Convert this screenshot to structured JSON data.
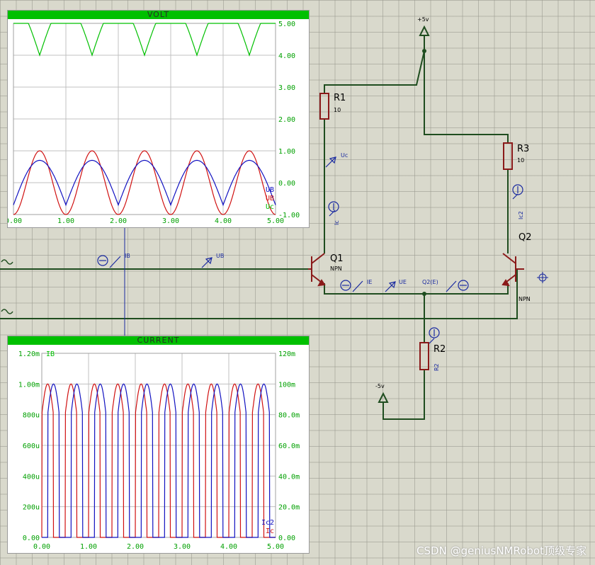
{
  "colors": {
    "wire": "#1f4d1f",
    "component": "#8b1a1a",
    "probe": "#1a2aa0",
    "trace_green": "#00c000",
    "trace_red": "#d01010",
    "trace_blue": "#1010c0"
  },
  "schematic": {
    "power_top": "+5v",
    "power_bottom": "-5v",
    "r1": {
      "name": "R1",
      "value": "10"
    },
    "r2": {
      "name": "R2"
    },
    "r3": {
      "name": "R3",
      "value": "10"
    },
    "q1": {
      "name": "Q1",
      "type": "NPN"
    },
    "q2": {
      "name": "Q2",
      "type": "NPN"
    },
    "probes": {
      "uc": "Uc",
      "ic": "Ic",
      "ic2": "Ic2",
      "ib": "IB",
      "ub": "UB",
      "ie": "IE",
      "ue": "UE",
      "q2e": "Q2(E)",
      "r2_probe": "R2"
    }
  },
  "watermark": "CSDN @geniusNMRobot顶级专家",
  "chart_data": [
    {
      "type": "line",
      "title": "VOLT",
      "x_ticks": [
        "0.00",
        "1.00",
        "2.00",
        "3.00",
        "4.00",
        "5.00"
      ],
      "y_ticks": [
        "5.00",
        "4.00",
        "3.00",
        "2.00",
        "1.00",
        "0.00",
        "-1.00"
      ],
      "xlim": [
        0,
        5
      ],
      "ylim": [
        -1,
        5
      ],
      "legend": [
        "UB",
        "UB",
        "Uc"
      ],
      "series": [
        {
          "name": "Uc",
          "color": "#00c000",
          "kind": "clipped_top",
          "high": 5.0,
          "low": 4.0,
          "period": 1.0,
          "phase": 0.0
        },
        {
          "name": "UB",
          "color": "#d01010",
          "kind": "sine",
          "amplitude": 1.0,
          "offset": 0.0,
          "period": 1.0,
          "phase": 0.25
        },
        {
          "name": "UB",
          "color": "#1010c0",
          "kind": "abs_sine",
          "amplitude": 0.7,
          "offset": -0.7,
          "period": 1.0,
          "phase": 0.0
        }
      ]
    },
    {
      "type": "line",
      "title": "CURRENT",
      "x_ticks": [
        "0.00",
        "1.00",
        "2.00",
        "3.00",
        "4.00",
        "5.00"
      ],
      "y_ticks_left": [
        "1.20m",
        "1.00m",
        "800u",
        "600u",
        "400u",
        "200u",
        "0.00"
      ],
      "y_ticks_right": [
        "120m",
        "100m",
        "80.0m",
        "60.0m",
        "40.0m",
        "20.0m",
        "0.00"
      ],
      "xlim": [
        0,
        5
      ],
      "ylim_left": [
        0,
        1.2
      ],
      "legend_top": "IB",
      "legend": [
        "Ic2",
        "Ic"
      ],
      "series": [
        {
          "name": "Ic",
          "color": "#d01010",
          "kind": "pulse",
          "high": 1.0,
          "period": 0.5,
          "phase": 0.0
        },
        {
          "name": "Ic2",
          "color": "#1010c0",
          "kind": "pulse",
          "high": 1.0,
          "period": 0.5,
          "phase": 0.25
        }
      ]
    }
  ]
}
